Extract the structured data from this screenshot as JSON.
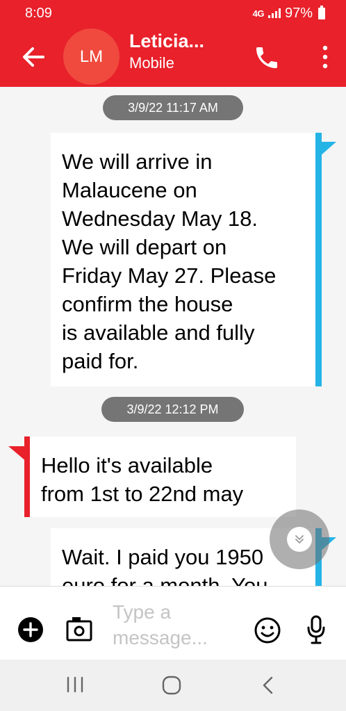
{
  "status_bar": {
    "time": "8:09",
    "network": "4G",
    "battery": "97%"
  },
  "header": {
    "avatar_initials": "LM",
    "contact_name": "Leticia...",
    "contact_subtitle": "Mobile"
  },
  "conversation": {
    "timestamp_1": "3/9/22 11:17 AM",
    "outgoing_1": [
      "We will arrive in",
      "Malaucene on",
      "Wednesday May 18.",
      "We will depart on",
      "Friday May 27. Please",
      "confirm the house",
      "is available and fully",
      "paid for."
    ],
    "timestamp_2": "3/9/22 12:12 PM",
    "incoming_1": [
      "Hello it's available",
      "from 1st to 22nd may"
    ],
    "outgoing_2": [
      "Wait. I paid you 1950",
      "euro for a month. You"
    ]
  },
  "composer": {
    "placeholder_line1": "Type a",
    "placeholder_line2": "message..."
  },
  "colors": {
    "brand_red": "#e8212b",
    "outgoing_accent": "#25b4e6",
    "timestamp_pill": "#757575"
  },
  "icons": {
    "back": "arrow-left-icon",
    "call": "phone-icon",
    "more": "more-vertical-icon",
    "add": "plus-circle-icon",
    "camera": "camera-icon",
    "emoji": "emoji-icon",
    "mic": "microphone-icon",
    "scroll": "chevron-double-down-icon"
  }
}
